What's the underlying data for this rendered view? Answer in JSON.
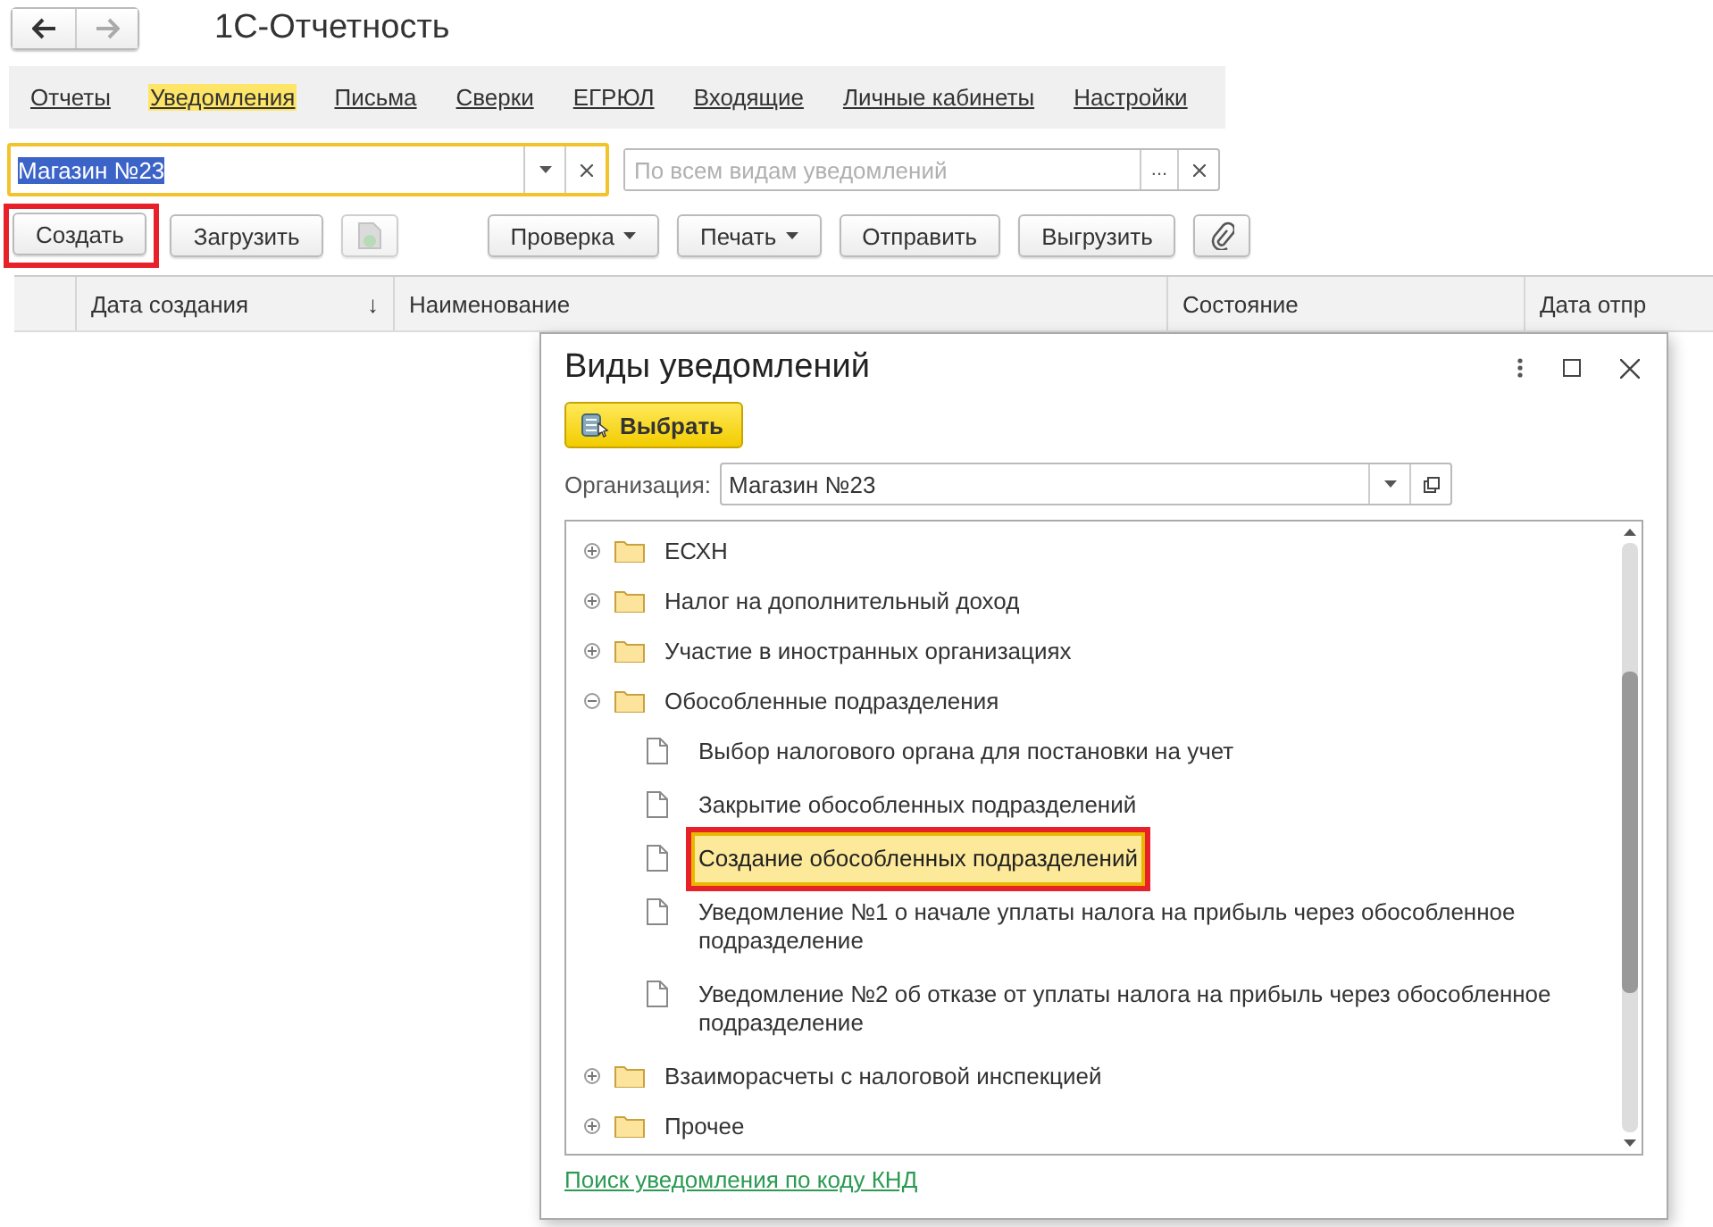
{
  "window": {
    "title": "1С-Отчетность"
  },
  "tabs": [
    {
      "label": "Отчеты",
      "selected": false
    },
    {
      "label": "Уведомления",
      "selected": true
    },
    {
      "label": "Письма",
      "selected": false
    },
    {
      "label": "Сверки",
      "selected": false
    },
    {
      "label": "ЕГРЮЛ",
      "selected": false
    },
    {
      "label": "Входящие",
      "selected": false
    },
    {
      "label": "Личные кабинеты",
      "selected": false
    },
    {
      "label": "Настройки",
      "selected": false
    }
  ],
  "filters": {
    "organization": {
      "value": "Магазин №23"
    },
    "kind": {
      "placeholder": "По всем видам уведомлений",
      "select": "..."
    }
  },
  "toolbar": [
    {
      "kind": "button",
      "label": "Создать",
      "highlighted": true
    },
    {
      "kind": "button",
      "label": "Загрузить",
      "highlighted": false
    },
    {
      "kind": "icon",
      "highlighted": false
    },
    {
      "kind": "menu",
      "label": "Проверка",
      "highlighted": false
    },
    {
      "kind": "menu",
      "label": "Печать",
      "highlighted": false
    },
    {
      "kind": "button",
      "label": "Отправить",
      "highlighted": false
    },
    {
      "kind": "button",
      "label": "Выгрузить",
      "highlighted": false
    },
    {
      "kind": "clip",
      "highlighted": false
    }
  ],
  "table": {
    "columns": [
      {
        "label": "Дата создания",
        "sort": "↓"
      },
      {
        "label": "Наименование"
      },
      {
        "label": "Состояние"
      },
      {
        "label": "Дата отпр"
      }
    ]
  },
  "dialog": {
    "title": "Виды уведомлений",
    "choose_button": "Выбрать",
    "org_label": "Организация:",
    "org_value": "Магазин №23",
    "tree": [
      {
        "label": "ЕСХН",
        "kind": "folder",
        "expanded": false
      },
      {
        "label": "Налог на дополнительный доход",
        "kind": "folder",
        "expanded": false
      },
      {
        "label": "Участие в иностранных организациях",
        "kind": "folder",
        "expanded": false
      },
      {
        "label": "Обособленные подразделения",
        "kind": "folder",
        "expanded": true,
        "children": [
          {
            "label": "Выбор налогового органа для постановки на учет",
            "kind": "doc",
            "selected": false
          },
          {
            "label": "Закрытие обособленных подразделений",
            "kind": "doc",
            "selected": false
          },
          {
            "label": "Создание обособленных подразделений",
            "kind": "doc",
            "selected": true
          },
          {
            "label": "Уведомление №1 о начале уплаты налога на прибыль через обособленное подразделение",
            "kind": "doc",
            "selected": false
          },
          {
            "label": "Уведомление №2 об отказе от уплаты налога на прибыль через обособленное подразделение",
            "kind": "doc",
            "selected": false
          }
        ]
      },
      {
        "label": "Взаиморасчеты с налоговой инспекцией",
        "kind": "folder",
        "expanded": false
      },
      {
        "label": "Прочее",
        "kind": "folder",
        "expanded": false
      }
    ],
    "link": "Поиск уведомления по коду КНД"
  }
}
